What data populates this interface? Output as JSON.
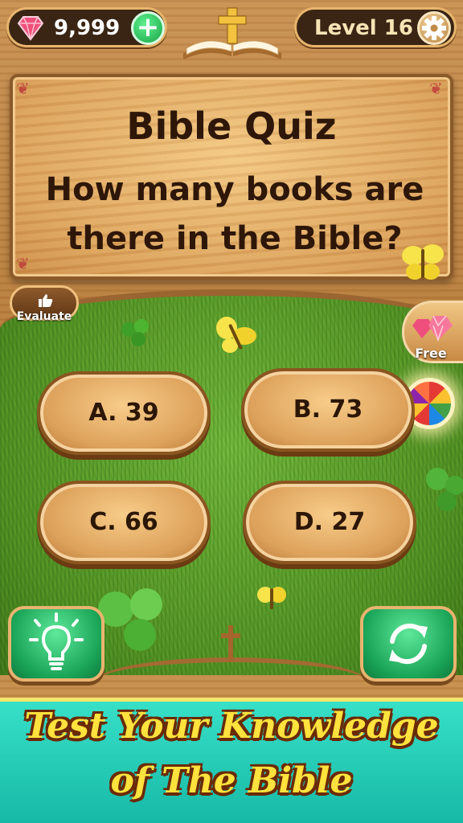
{
  "header": {
    "gems": "9,999",
    "add_label": "+",
    "level": "Level 16"
  },
  "board": {
    "title": "Bible Quiz",
    "question_line1": "How many books are",
    "question_line2": "there in the Bible?"
  },
  "side": {
    "evaluate": "Evaluate",
    "free": "Free"
  },
  "answers": [
    {
      "label": "A. 39"
    },
    {
      "label": "B. 73"
    },
    {
      "label": "C. 66"
    },
    {
      "label": "D. 27"
    }
  ],
  "banner": {
    "line1": "Test Your Knowledge",
    "line2": "of The Bible"
  },
  "icons": {
    "gem": "gem-icon",
    "settings": "gear-icon",
    "book": "book-cross-icon",
    "hint": "lightbulb-icon",
    "refresh": "refresh-icon"
  },
  "colors": {
    "answer_text": "#2c1606",
    "green_button": "#19a356",
    "banner_bg": "#16b9a6",
    "banner_text": "#ffe23d"
  }
}
